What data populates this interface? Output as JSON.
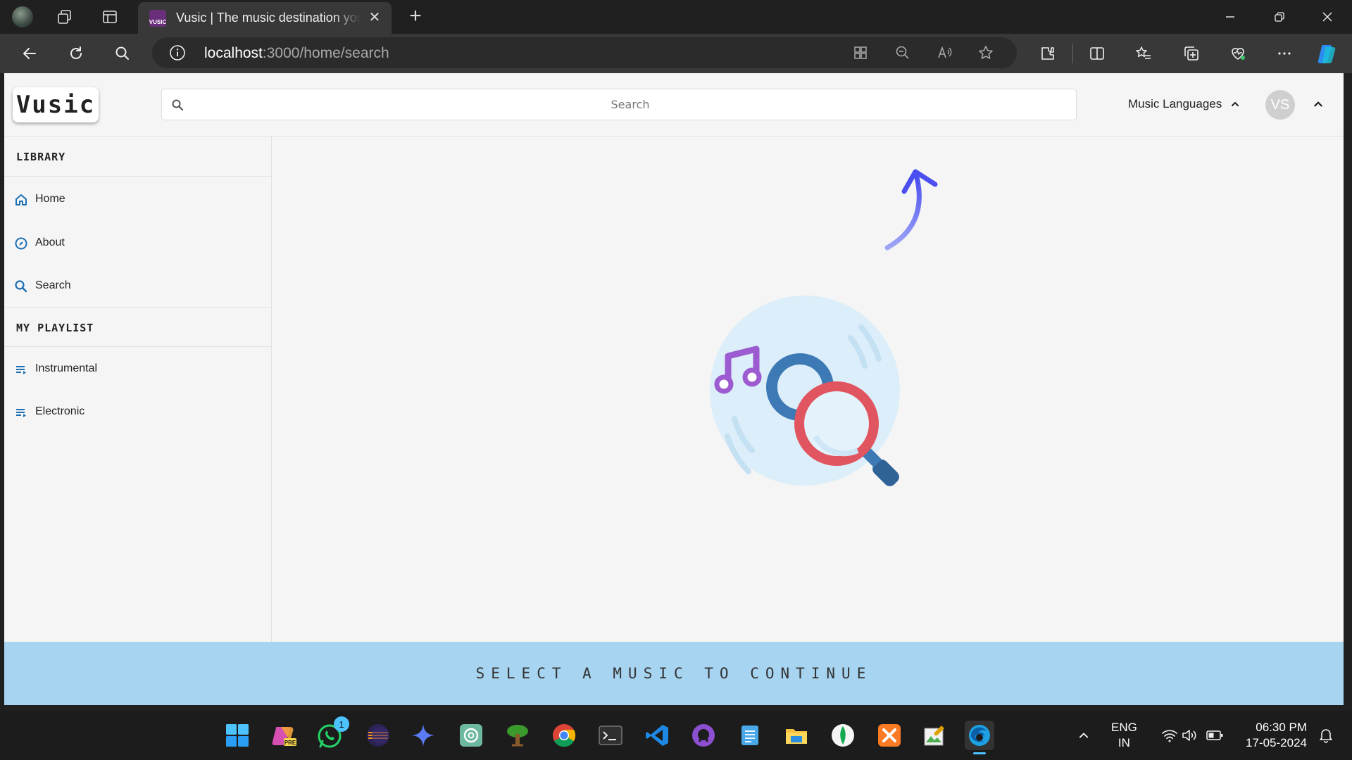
{
  "browser": {
    "tab_title": "Vusic | The music destination you",
    "tab_favicon_text": "VUSIC",
    "close_tab_glyph": "✕",
    "new_tab_glyph": "+",
    "url_host": "localhost",
    "url_path": ":3000/home/search"
  },
  "app": {
    "logo_text": "Vusic",
    "search_placeholder": "Search",
    "music_languages_label": "Music Languages",
    "avatar_initials": "VS"
  },
  "sidebar": {
    "library_heading": "LIBRARY",
    "library_items": [
      {
        "label": "Home",
        "icon": "home-icon"
      },
      {
        "label": "About",
        "icon": "compass-icon"
      },
      {
        "label": "Search",
        "icon": "search-icon"
      }
    ],
    "playlist_heading": "MY PLAYLIST",
    "playlist_items": [
      {
        "label": "Instrumental",
        "icon": "playlist-icon"
      },
      {
        "label": "Electronic",
        "icon": "playlist-icon"
      }
    ]
  },
  "footer": {
    "message": "SELECT A MUSIC TO CONTINUE"
  },
  "taskbar": {
    "whatsapp_badge": "1",
    "lang_line1": "ENG",
    "lang_line2": "IN",
    "time": "06:30 PM",
    "date": "17-05-2024"
  },
  "colors": {
    "accent_blue": "#1c6fb4",
    "footer_bg": "#a7d4f0",
    "arrow": "#5a5cf0",
    "magnifier_red": "#e05560",
    "magnifier_blue": "#3d7ab5",
    "music_note": "#9c5bd0",
    "disc_bg": "#dceef9"
  }
}
